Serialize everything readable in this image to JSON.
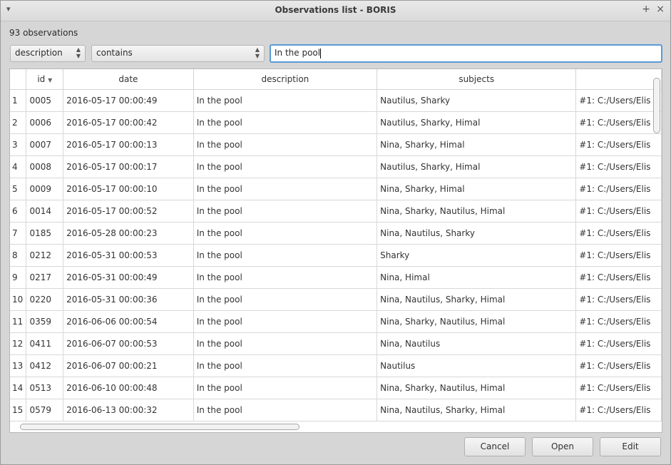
{
  "window": {
    "title": "Observations list - BORIS",
    "menu_icon": "▾",
    "max_icon": "+",
    "close_icon": "×"
  },
  "count_label": "93 observations",
  "filter": {
    "field": "description",
    "operator": "contains",
    "text": "In the pool"
  },
  "columns": [
    "id",
    "date",
    "description",
    "subjects",
    ""
  ],
  "sort_icon": "▼",
  "rows": [
    {
      "n": "1",
      "id": "0005",
      "date": "2016-05-17 00:00:49",
      "description": "In the pool",
      "subjects": "Nautilus, Sharky",
      "media": "#1: C:/Users/Elis"
    },
    {
      "n": "2",
      "id": "0006",
      "date": "2016-05-17 00:00:42",
      "description": "In the pool",
      "subjects": "Nautilus, Sharky, Himal",
      "media": "#1: C:/Users/Elis"
    },
    {
      "n": "3",
      "id": "0007",
      "date": "2016-05-17 00:00:13",
      "description": "In the pool",
      "subjects": "Nina, Sharky, Himal",
      "media": "#1: C:/Users/Elis"
    },
    {
      "n": "4",
      "id": "0008",
      "date": "2016-05-17 00:00:17",
      "description": "In the pool",
      "subjects": "Nautilus, Sharky, Himal",
      "media": "#1: C:/Users/Elis"
    },
    {
      "n": "5",
      "id": "0009",
      "date": "2016-05-17 00:00:10",
      "description": "In the pool",
      "subjects": "Nina, Sharky, Himal",
      "media": "#1: C:/Users/Elis"
    },
    {
      "n": "6",
      "id": "0014",
      "date": "2016-05-17 00:00:52",
      "description": "In the pool",
      "subjects": "Nina, Sharky, Nautilus, Himal",
      "media": "#1: C:/Users/Elis"
    },
    {
      "n": "7",
      "id": "0185",
      "date": "2016-05-28 00:00:23",
      "description": "In the pool",
      "subjects": "Nina, Nautilus, Sharky",
      "media": "#1: C:/Users/Elis"
    },
    {
      "n": "8",
      "id": "0212",
      "date": "2016-05-31 00:00:53",
      "description": "In the pool",
      "subjects": "Sharky",
      "media": "#1: C:/Users/Elis"
    },
    {
      "n": "9",
      "id": "0217",
      "date": "2016-05-31 00:00:49",
      "description": "In the pool",
      "subjects": "Nina, Himal",
      "media": "#1: C:/Users/Elis"
    },
    {
      "n": "10",
      "id": "0220",
      "date": "2016-05-31 00:00:36",
      "description": "In the pool",
      "subjects": "Nina, Nautilus, Sharky, Himal",
      "media": "#1: C:/Users/Elis"
    },
    {
      "n": "11",
      "id": "0359",
      "date": "2016-06-06 00:00:54",
      "description": "In the pool",
      "subjects": "Nina, Sharky, Nautilus, Himal",
      "media": "#1: C:/Users/Elis"
    },
    {
      "n": "12",
      "id": "0411",
      "date": "2016-06-07 00:00:53",
      "description": "In the pool",
      "subjects": "Nina, Nautilus",
      "media": "#1: C:/Users/Elis"
    },
    {
      "n": "13",
      "id": "0412",
      "date": "2016-06-07 00:00:21",
      "description": "In the pool",
      "subjects": "Nautilus",
      "media": "#1: C:/Users/Elis"
    },
    {
      "n": "14",
      "id": "0513",
      "date": "2016-06-10 00:00:48",
      "description": "In the pool",
      "subjects": "Nina, Sharky, Nautilus, Himal",
      "media": "#1: C:/Users/Elis"
    },
    {
      "n": "15",
      "id": "0579",
      "date": "2016-06-13 00:00:32",
      "description": "In the pool",
      "subjects": "Nina, Nautilus, Sharky, Himal",
      "media": "#1: C:/Users/Elis"
    }
  ],
  "buttons": {
    "cancel": "Cancel",
    "open": "Open",
    "edit": "Edit"
  }
}
